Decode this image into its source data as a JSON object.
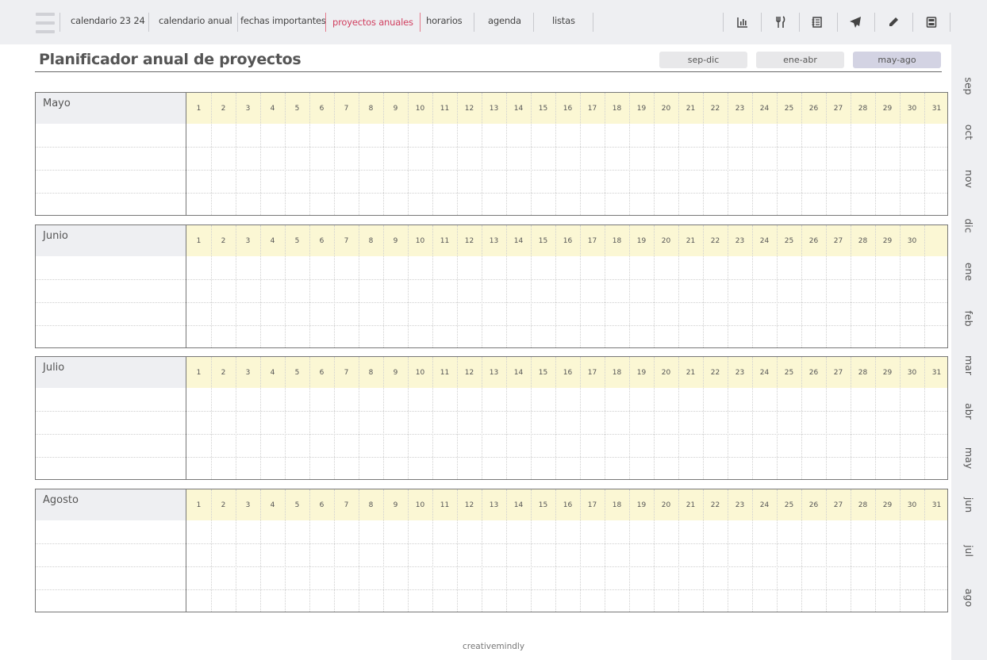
{
  "nav": {
    "items": [
      {
        "label": "calendario 23 24",
        "active": false
      },
      {
        "label": "calendario anual",
        "active": false
      },
      {
        "label": "fechas importantes",
        "active": false
      },
      {
        "label": "proyectos anuales",
        "active": true
      },
      {
        "label": "horarios",
        "active": false
      },
      {
        "label": "agenda",
        "active": false
      },
      {
        "label": "listas",
        "active": false
      }
    ],
    "tools": [
      "chart-icon",
      "utensils-icon",
      "notebook-icon",
      "plane-icon",
      "pencil-icon",
      "calculator-icon"
    ]
  },
  "page": {
    "title": "Planificador anual de proyectos",
    "ranges": [
      {
        "label": "sep-dic",
        "active": false
      },
      {
        "label": "ene-abr",
        "active": false
      },
      {
        "label": "may-ago",
        "active": true
      }
    ]
  },
  "months": [
    {
      "name": "Mayo",
      "days": 31
    },
    {
      "name": "Junio",
      "days": 30
    },
    {
      "name": "Julio",
      "days": 31
    },
    {
      "name": "Agosto",
      "days": 31
    }
  ],
  "side_months": [
    "sep",
    "oct",
    "nov",
    "dic",
    "ene",
    "feb",
    "mar",
    "abr",
    "may",
    "jun",
    "jul",
    "ago"
  ],
  "footer": "creativemindly",
  "colors": {
    "header_bg": "#fbf7d4",
    "active_tab": "#e47a8c",
    "active_range": "#d3d3e3",
    "bar_bg": "#eeeff2"
  }
}
